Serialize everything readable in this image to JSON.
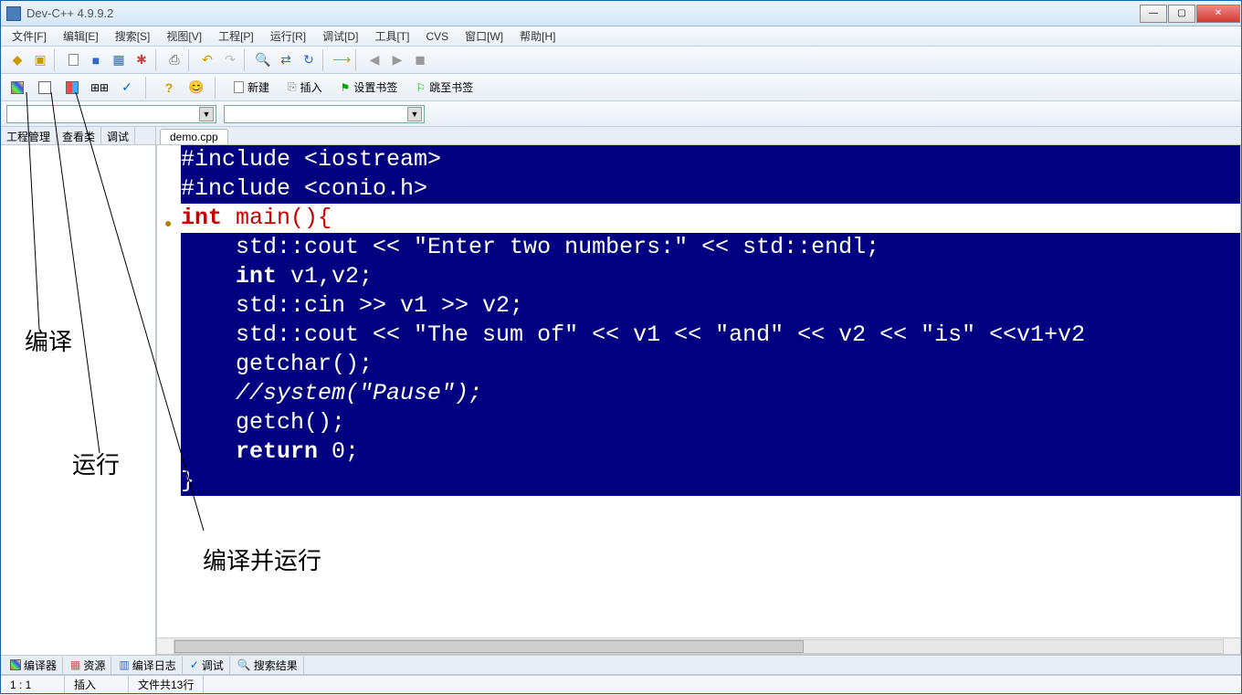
{
  "title": "Dev-C++ 4.9.9.2",
  "menu": [
    "文件[F]",
    "编辑[E]",
    "搜索[S]",
    "视图[V]",
    "工程[P]",
    "运行[R]",
    "调试[D]",
    "工具[T]",
    "CVS",
    "窗口[W]",
    "帮助[H]"
  ],
  "toolbar2": {
    "new": "新建",
    "insert": "插入",
    "set_bookmark": "设置书签",
    "goto_bookmark": "跳至书签"
  },
  "side_tabs": [
    "工程管理",
    "查看类",
    "调试"
  ],
  "file_tab": "demo.cpp",
  "code_lines": [
    {
      "sel": true,
      "html": "#include &lt;iostream&gt;"
    },
    {
      "sel": true,
      "html": "#include &lt;conio.h&gt;"
    },
    {
      "sel": false,
      "main": true,
      "html": "<span class='kw'>int</span> main(){"
    },
    {
      "sel": true,
      "html": "    std::cout &lt;&lt; \"Enter two numbers:\" &lt;&lt; std::endl;"
    },
    {
      "sel": true,
      "html": "    <span class='kw'>int</span> v1,v2;"
    },
    {
      "sel": true,
      "html": "    std::cin &gt;&gt; v1 &gt;&gt; v2;"
    },
    {
      "sel": true,
      "html": "    std::cout &lt;&lt; \"The sum of\" &lt;&lt; v1 &lt;&lt; \"and\" &lt;&lt; v2 &lt;&lt; \"is\" &lt;&lt;v1+v2"
    },
    {
      "sel": true,
      "html": "    getchar();"
    },
    {
      "sel": true,
      "comment": true,
      "html": "    <span class='comment'>//system(\"Pause\");</span>"
    },
    {
      "sel": true,
      "html": "    getch();"
    },
    {
      "sel": true,
      "html": "    <span class='kw'>return</span> 0;"
    },
    {
      "sel": true,
      "html": "}"
    }
  ],
  "bottom_tabs": [
    "编译器",
    "资源",
    "编译日志",
    "调试",
    "搜索结果"
  ],
  "status": {
    "pos": "1 : 1",
    "mode": "插入",
    "lines": "文件共13行"
  },
  "annotations": {
    "compile": "编译",
    "run": "运行",
    "compile_run": "编译并运行"
  }
}
